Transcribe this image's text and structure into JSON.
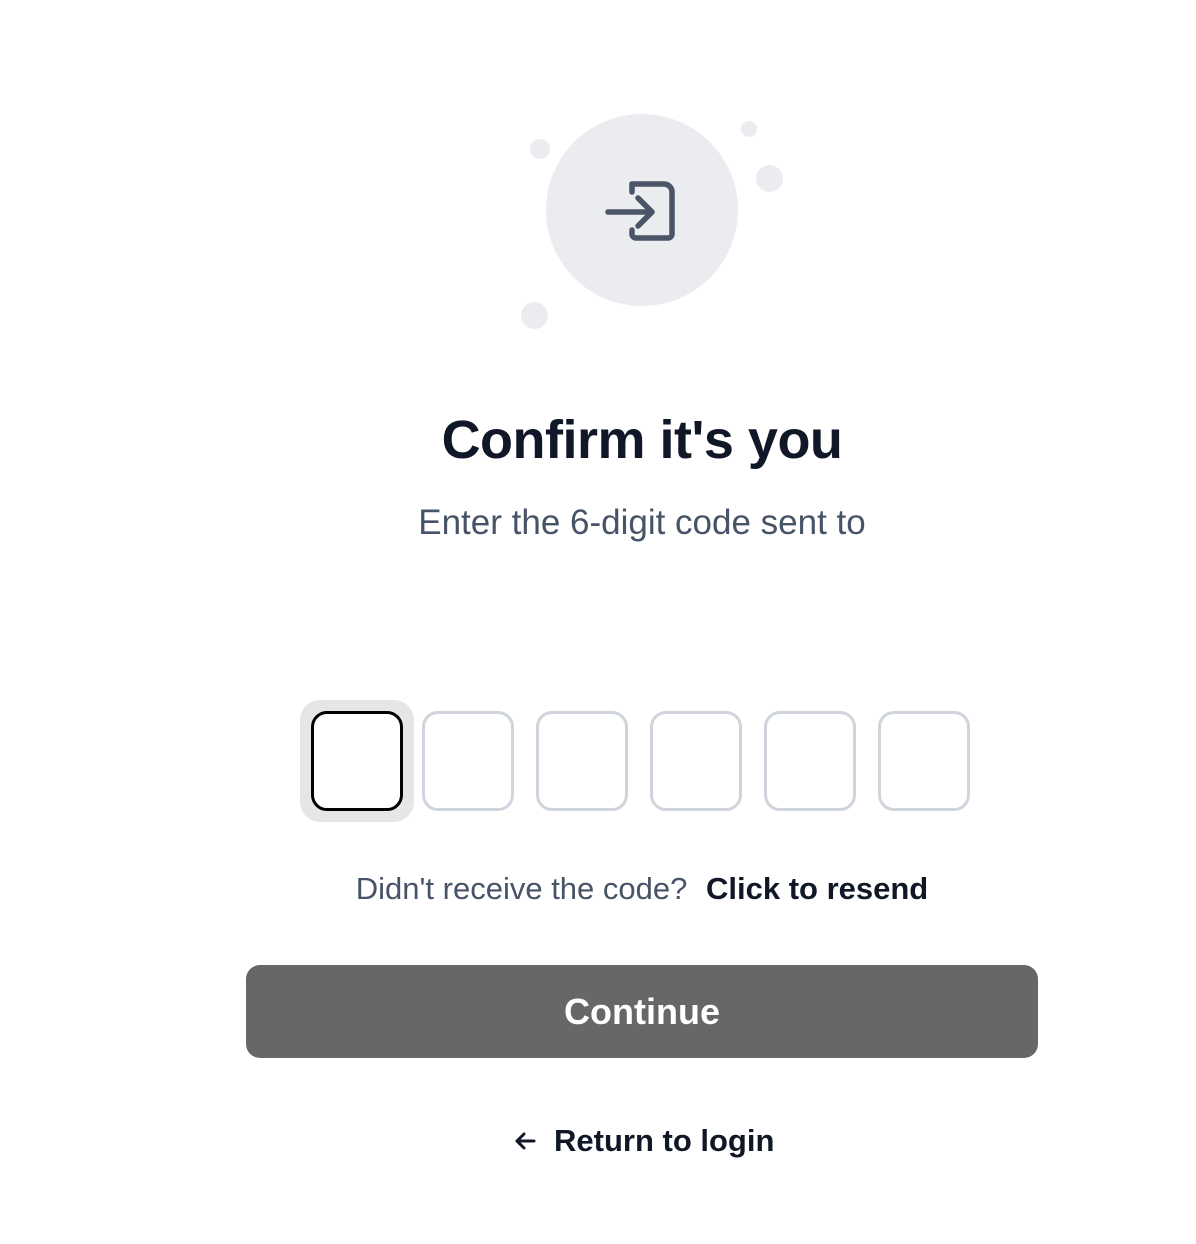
{
  "hero": {
    "icon": "login-icon"
  },
  "heading": {
    "title": "Confirm it's you",
    "subtitle": "Enter the 6-digit code sent to"
  },
  "otp": {
    "length": 6,
    "values": [
      "",
      "",
      "",
      "",
      "",
      ""
    ]
  },
  "resend": {
    "prompt": "Didn't receive the code?",
    "link_label": "Click to resend"
  },
  "actions": {
    "continue_label": "Continue",
    "return_label": "Return to login",
    "return_icon": "arrow-left-icon"
  },
  "colors": {
    "button_bg": "#676767",
    "heading": "#101828",
    "muted": "#475467",
    "circle": "#eaecf0",
    "box_border": "#d0d5dd"
  }
}
